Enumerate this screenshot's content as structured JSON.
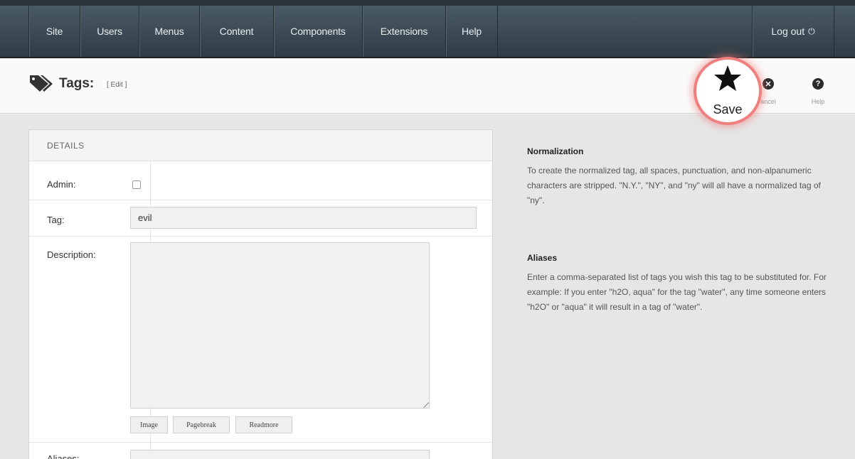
{
  "nav": {
    "items": [
      "Site",
      "Users",
      "Menus",
      "Content",
      "Components",
      "Extensions",
      "Help"
    ],
    "logout_label": "Log out"
  },
  "title": {
    "main": "Tags:",
    "sub": "[ Edit ]"
  },
  "toolbar": {
    "save_label": "Save",
    "cancel_label": "ancel",
    "help_label": "Help"
  },
  "form": {
    "header": "DETAILS",
    "admin_label": "Admin:",
    "tag_label": "Tag:",
    "tag_value": "evil",
    "description_label": "Description:",
    "aliases_label": "Aliases:",
    "editor_buttons": [
      "Image",
      "Pagebreak",
      "Readmore"
    ]
  },
  "help": {
    "normalization_title": "Normalization",
    "normalization_text": "To create the normalized tag, all spaces, punctuation, and non-alpanumeric characters are stripped. \"N.Y.\", \"NY\", and \"ny\" will all have a normalized tag of \"ny\".",
    "aliases_title": "Aliases",
    "aliases_text": "Enter a comma-separated list of tags you wish this tag to be substituted for. For example: If you enter \"h2O, aqua\" for the tag \"water\", any time someone enters \"h2O\" or \"aqua\" it will result in a tag of \"water\"."
  }
}
